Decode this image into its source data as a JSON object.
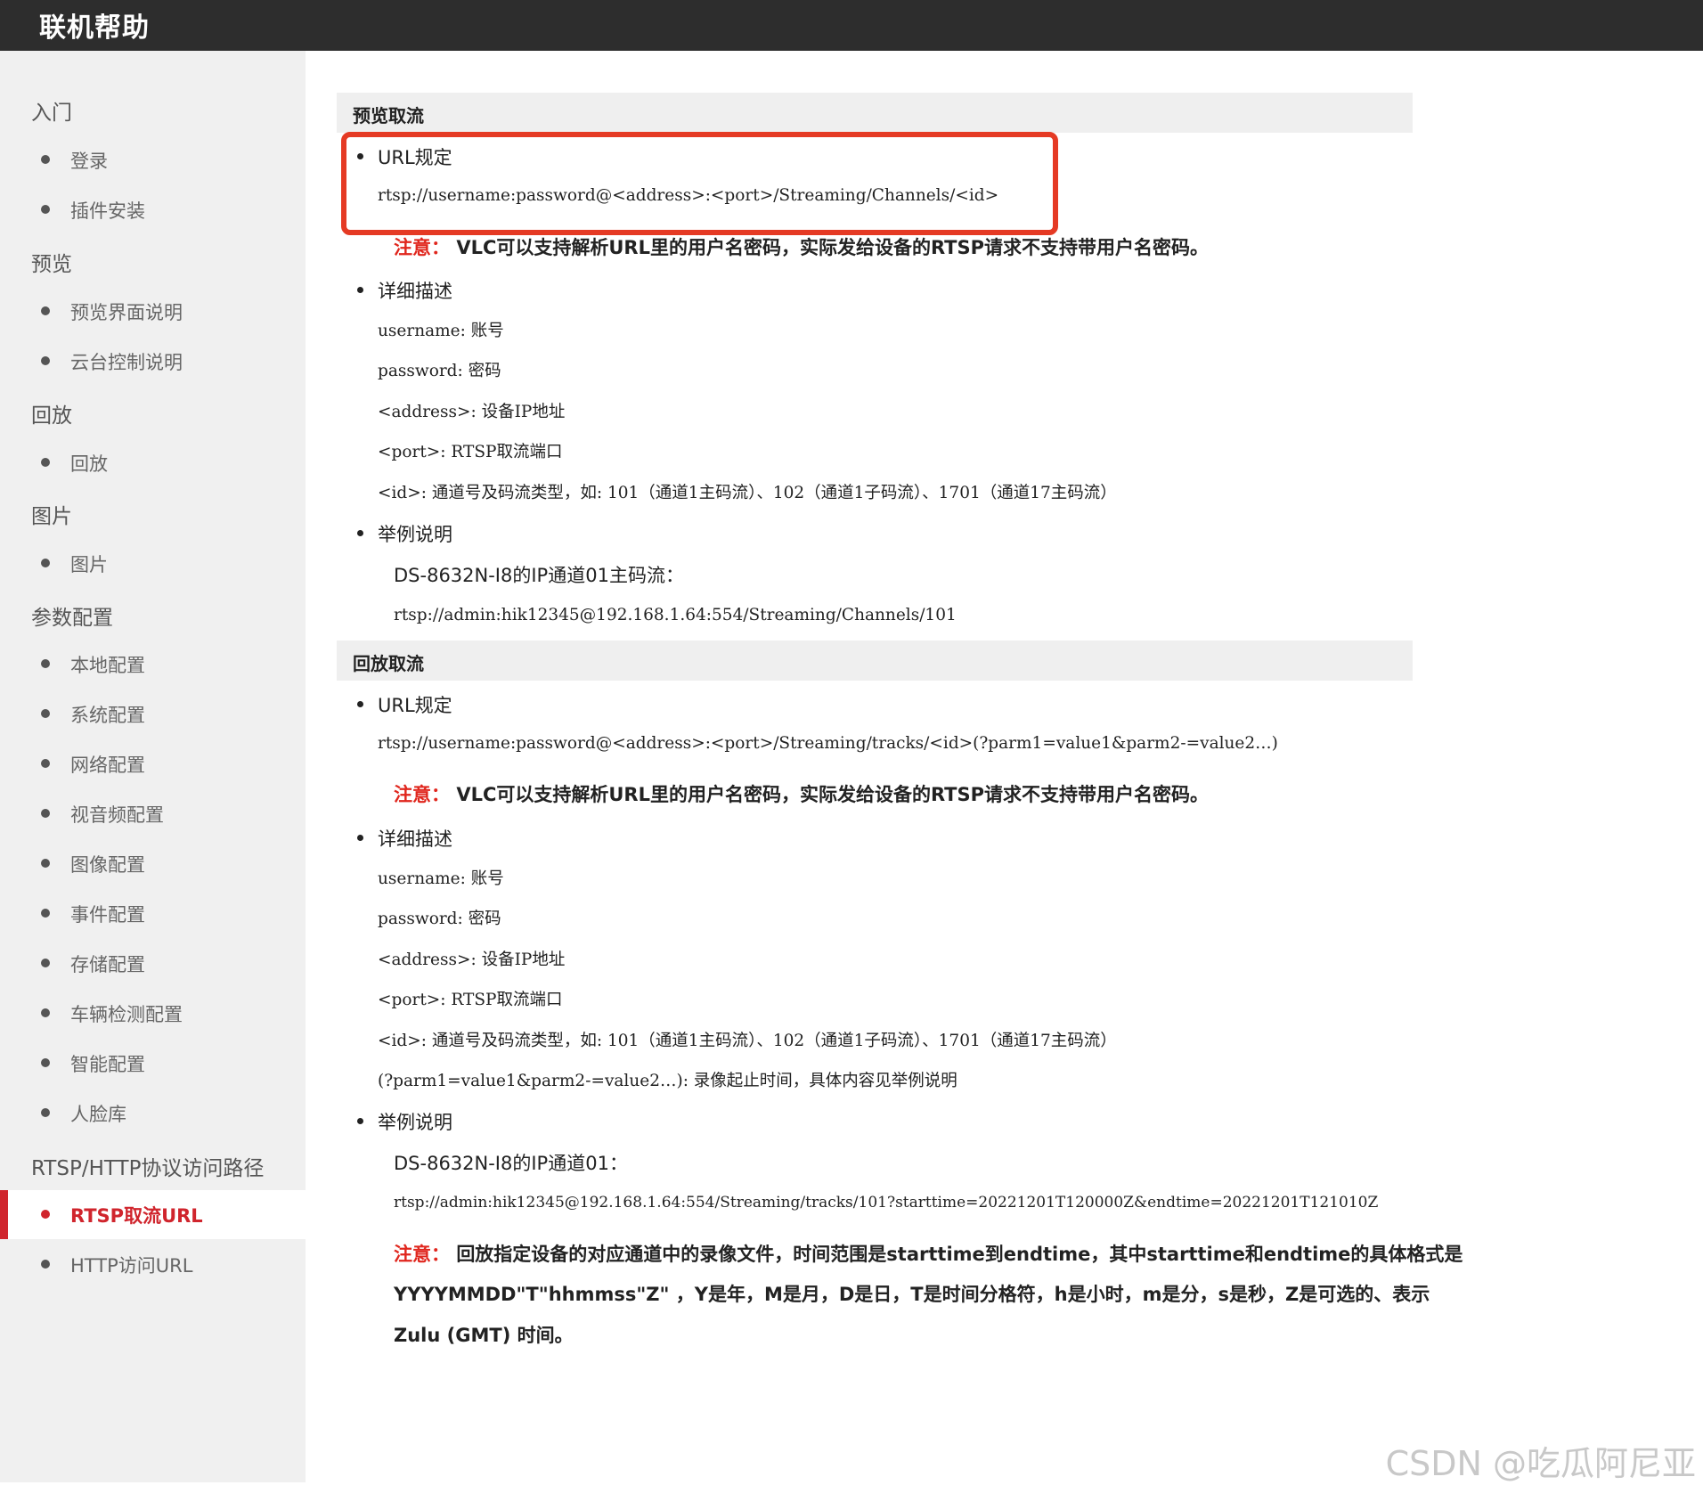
{
  "header": {
    "title": "联机帮助"
  },
  "sidebar": {
    "groups": [
      {
        "label": "入门",
        "items": [
          "登录",
          "插件安装"
        ]
      },
      {
        "label": "预览",
        "items": [
          "预览界面说明",
          "云台控制说明"
        ]
      },
      {
        "label": "回放",
        "items": [
          "回放"
        ]
      },
      {
        "label": "图片",
        "items": [
          "图片"
        ]
      },
      {
        "label": "参数配置",
        "items": [
          "本地配置",
          "系统配置",
          "网络配置",
          "视音频配置",
          "图像配置",
          "事件配置",
          "存储配置",
          "车辆检测配置",
          "智能配置",
          "人脸库"
        ]
      },
      {
        "label": "RTSP/HTTP协议访问路径",
        "items": [
          "RTSP取流URL",
          "HTTP访问URL"
        ]
      }
    ],
    "active_item": "RTSP取流URL"
  },
  "preview": {
    "heading": "预览取流",
    "url_rule_label": "URL规定",
    "url": "rtsp://username:password@<address>:<port>/Streaming/Channels/<id>",
    "note_label": "注意：",
    "note_text": "VLC可以支持解析URL里的用户名密码，实际发给设备的RTSP请求不支持带用户名密码。",
    "detail_label": "详细描述",
    "details": [
      "username: 账号",
      "password: 密码",
      "<address>: 设备IP地址",
      "<port>: RTSP取流端口",
      "<id>: 通道号及码流类型，如: 101（通道1主码流）、102（通道1子码流）、1701（通道17主码流）"
    ],
    "example_label": "举例说明",
    "example_title": "DS-8632N-I8的IP通道01主码流：",
    "example_url": "rtsp://admin:hik12345@192.168.1.64:554/Streaming/Channels/101"
  },
  "playback": {
    "heading": "回放取流",
    "url_rule_label": "URL规定",
    "url": "rtsp://username:password@<address>:<port>/Streaming/tracks/<id>(?parm1=value1&parm2-=value2…)",
    "note_label": "注意：",
    "note_text": "VLC可以支持解析URL里的用户名密码，实际发给设备的RTSP请求不支持带用户名密码。",
    "detail_label": "详细描述",
    "details": [
      "username: 账号",
      "password: 密码",
      "<address>: 设备IP地址",
      "<port>: RTSP取流端口",
      "<id>: 通道号及码流类型，如: 101（通道1主码流）、102（通道1子码流）、1701（通道17主码流）",
      "(?parm1=value1&parm2-=value2…): 录像起止时间，具体内容见举例说明"
    ],
    "example_label": "举例说明",
    "example_title": "DS-8632N-I8的IP通道01：",
    "example_url": "rtsp://admin:hik12345@192.168.1.64:554/Streaming/tracks/101?starttime=20221201T120000Z&endtime=20221201T121010Z",
    "note2_label": "注意：",
    "note2_lines": [
      "回放指定设备的对应通道中的录像文件，时间范围是starttime到endtime，其中starttime和endtime的具体格式是",
      "YYYYMMDD\"T\"hhmmss\"Z\" ，Y是年，M是月，D是日，T是时间分格符，h是小时，m是分，s是秒，Z是可选的、表示",
      "Zulu (GMT) 时间。"
    ]
  },
  "watermark": "CSDN @吃瓜阿尼亚"
}
